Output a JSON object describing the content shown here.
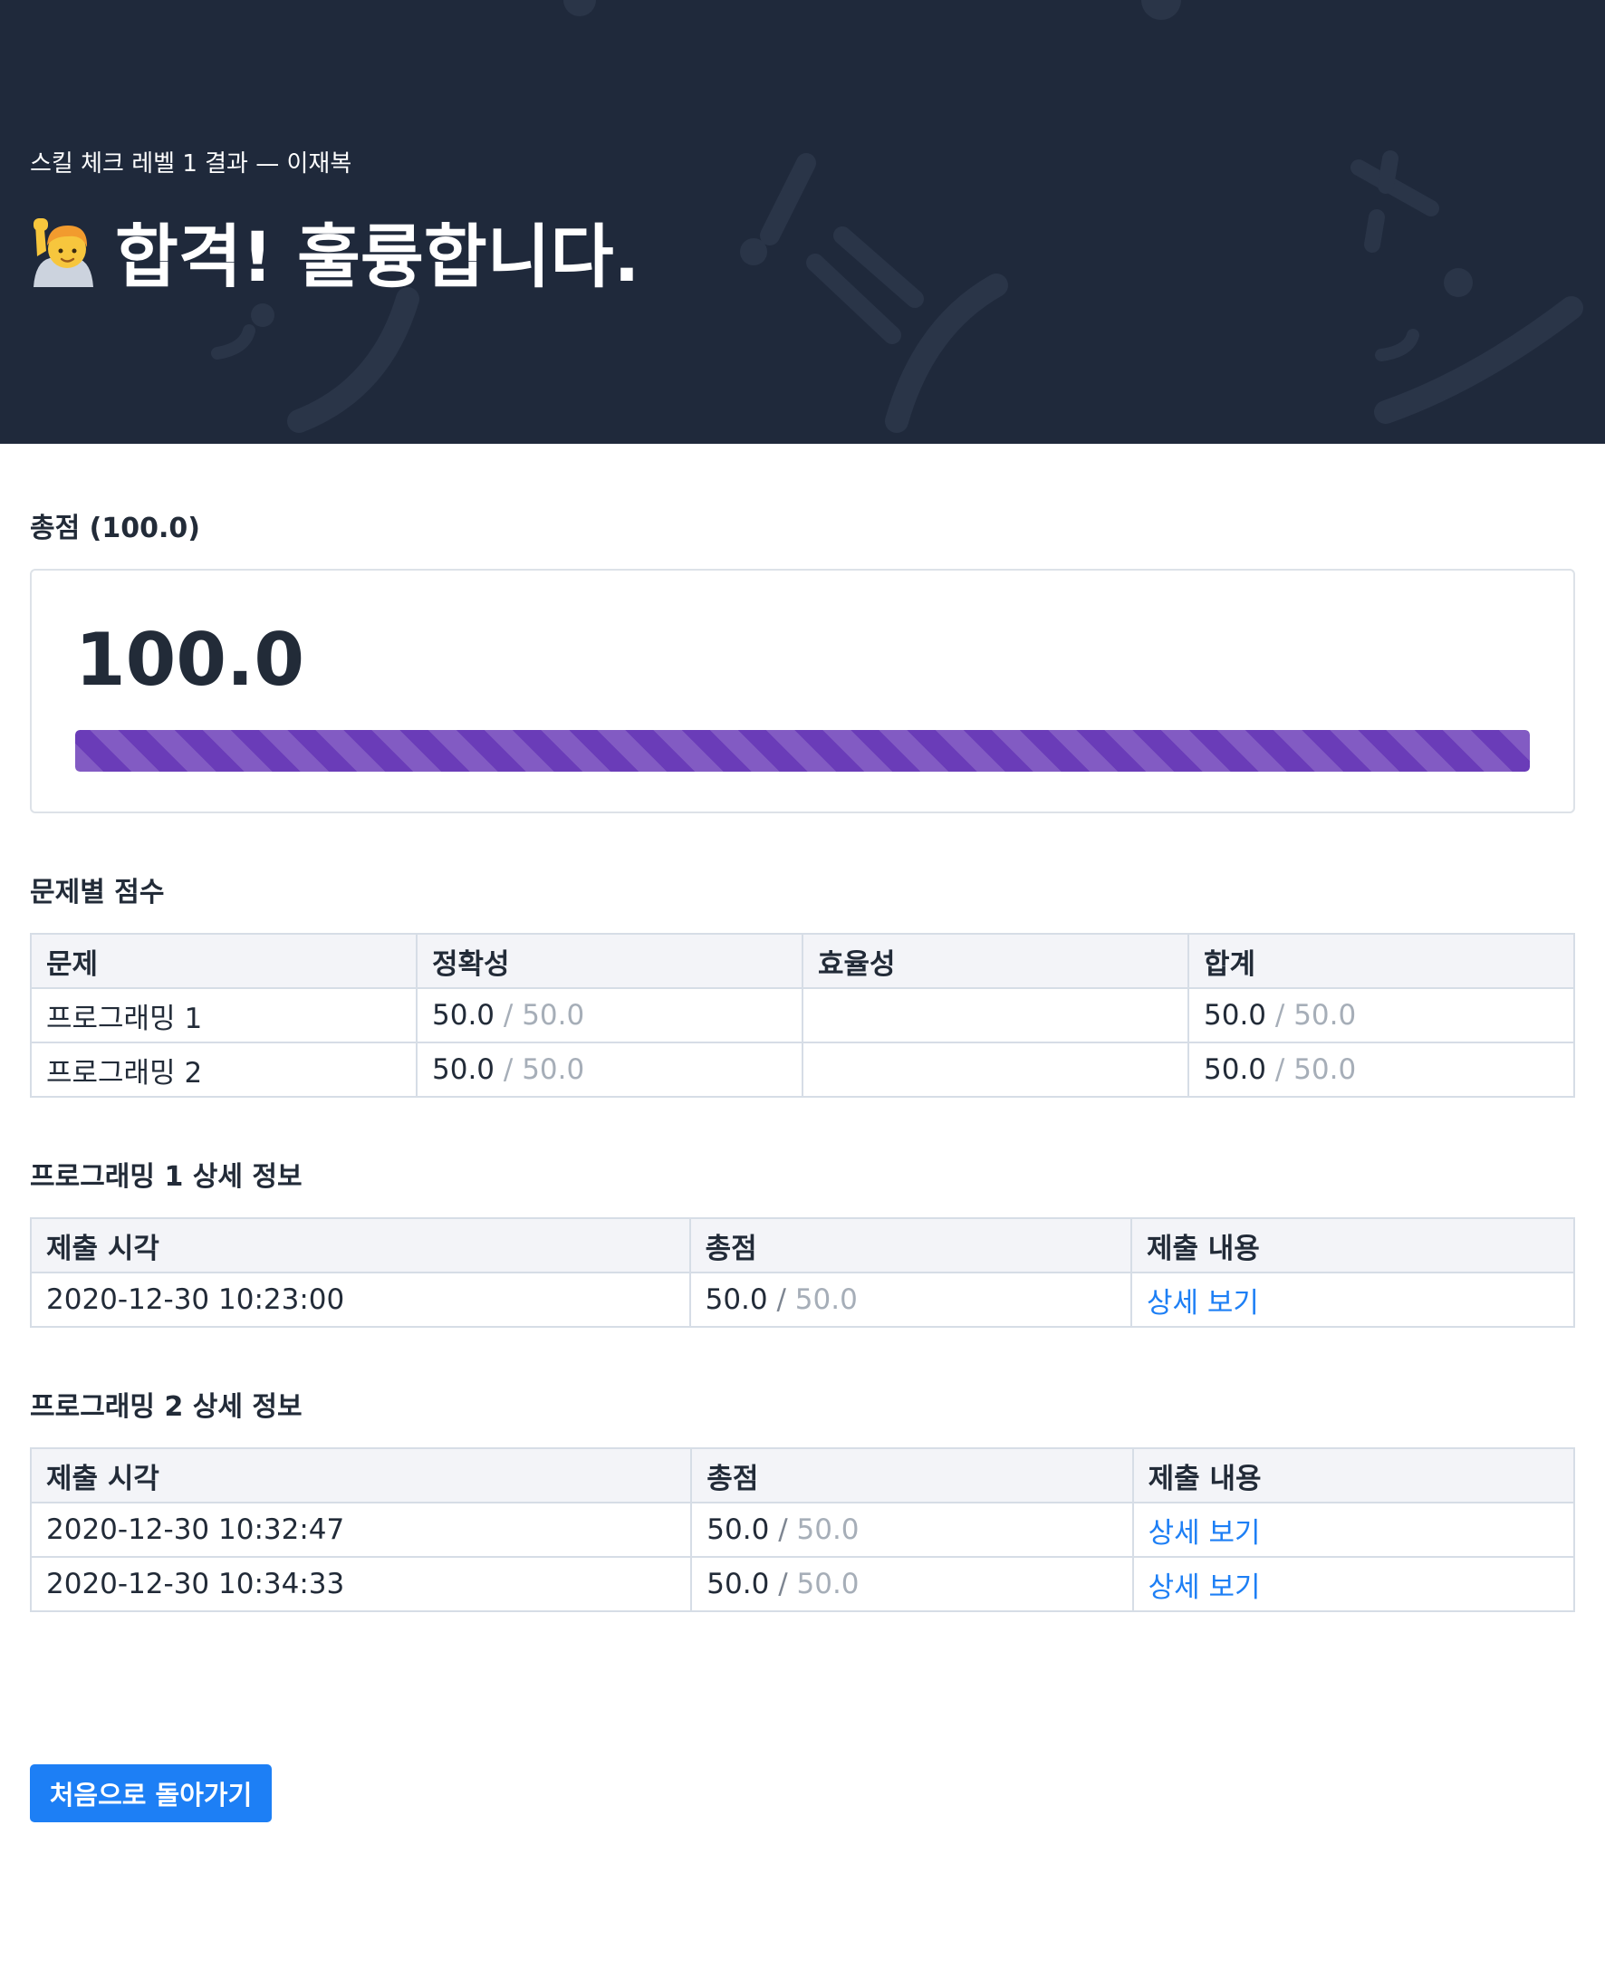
{
  "header": {
    "subtitle": "스킬 체크 레벨 1 결과 — 이재복",
    "title": "합격! 훌륭합니다.",
    "emoji_icon": "person-raising-hand-icon"
  },
  "total": {
    "title": "총점 (100.0)",
    "value": "100.0",
    "progress_percent": 100,
    "progress_color": "#6a3cb8"
  },
  "scores_by_problem": {
    "title": "문제별 점수",
    "columns": [
      "문제",
      "정확성",
      "효율성",
      "합계"
    ],
    "rows": [
      {
        "problem": "프로그래밍 1",
        "accuracy": "50.0",
        "accuracy_max": "50.0",
        "efficiency": "",
        "total": "50.0",
        "total_max": "50.0"
      },
      {
        "problem": "프로그래밍 2",
        "accuracy": "50.0",
        "accuracy_max": "50.0",
        "efficiency": "",
        "total": "50.0",
        "total_max": "50.0"
      }
    ]
  },
  "detail_1": {
    "title": "프로그래밍 1 상세 정보",
    "columns": [
      "제출 시각",
      "총점",
      "제출 내용"
    ],
    "rows": [
      {
        "time": "2020-12-30 10:23:00",
        "score": "50.0",
        "score_max": "50.0",
        "link": "상세 보기"
      }
    ]
  },
  "detail_2": {
    "title": "프로그래밍 2 상세 정보",
    "columns": [
      "제출 시각",
      "총점",
      "제출 내용"
    ],
    "rows": [
      {
        "time": "2020-12-30 10:32:47",
        "score": "50.0",
        "score_max": "50.0",
        "link": "상세 보기"
      },
      {
        "time": "2020-12-30 10:34:33",
        "score": "50.0",
        "score_max": "50.0",
        "link": "상세 보기"
      }
    ]
  },
  "separator": "/",
  "back_button": "처음으로 돌아가기",
  "colors": {
    "header_bg": "#1f293b",
    "link": "#1d7ff5",
    "button": "#1d7ff5",
    "muted": "#a6aeb8"
  }
}
